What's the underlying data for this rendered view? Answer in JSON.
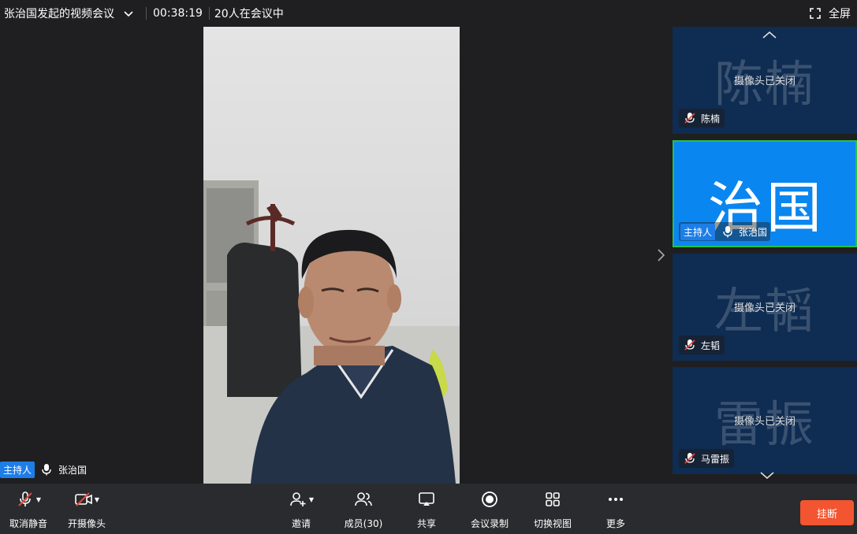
{
  "topbar": {
    "title": "张治国发起的视频会议",
    "timer": "00:38:19",
    "participants_text": "20人在会议中",
    "fullscreen_label": "全屏"
  },
  "main_video": {
    "host_badge": "主持人",
    "speaker_name": "张治国"
  },
  "sidebar": {
    "tiles": [
      {
        "avatar_text": "陈楠",
        "camera_status": "摄像头已关闭",
        "name": "陈楠",
        "muted": true
      },
      {
        "avatar_text": "治国",
        "host_badge": "主持人",
        "name": "张治国",
        "muted": false
      },
      {
        "avatar_text": "左韬",
        "camera_status": "摄像头已关闭",
        "name": "左韬",
        "muted": true
      },
      {
        "avatar_text": "雷振",
        "camera_status": "摄像头已关闭",
        "name": "马雷振",
        "muted": true
      }
    ]
  },
  "toolbar": {
    "unmute_label": "取消静音",
    "camera_label": "开摄像头",
    "invite_label": "邀请",
    "members_label": "成员(30)",
    "share_label": "共享",
    "record_label": "会议录制",
    "switch_view_label": "切换视图",
    "more_label": "更多",
    "hangup_label": "挂断"
  },
  "colors": {
    "accent_blue": "#0a86f0",
    "host_badge": "#1e7ee8",
    "active_border": "#27c049",
    "hangup": "#f25530",
    "muted_red": "#e5473c"
  }
}
